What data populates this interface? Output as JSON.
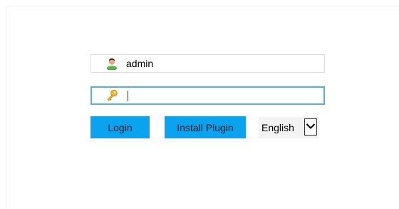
{
  "login_form": {
    "username": {
      "value": "admin",
      "icon": "user-icon"
    },
    "password": {
      "value": "",
      "icon": "key-icon"
    },
    "buttons": {
      "login_label": "Login",
      "install_plugin_label": "Install Plugin"
    },
    "language": {
      "selected": "English",
      "icon": "chevron-down-icon"
    }
  },
  "colors": {
    "button_bg": "#0aa3f0",
    "focus_border": "#58aee0"
  }
}
